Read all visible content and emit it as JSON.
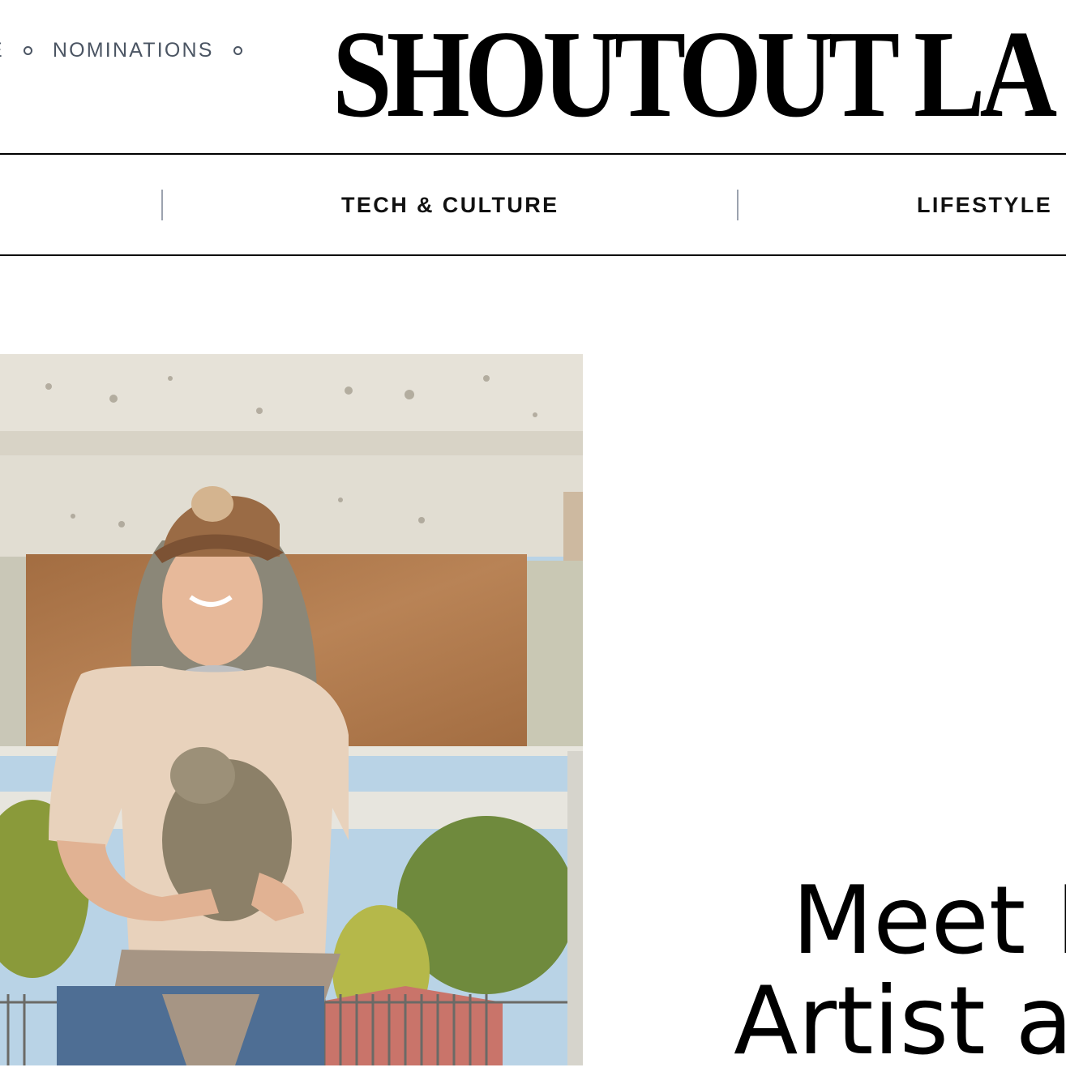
{
  "top_nav": {
    "partial_item": "E",
    "item": "NOMINATIONS"
  },
  "site": {
    "logo": "SHOUTOUT LA"
  },
  "category_nav": {
    "items": [
      "TECH & CULTURE",
      "LIFESTYLE"
    ]
  },
  "article": {
    "headline_line1": "Meet I",
    "headline_line2": "Artist a"
  },
  "colors": {
    "text": "#000000",
    "nav_gray": "#4b5563",
    "separator": "#9ca3af"
  },
  "icons": [
    "circle-bullet-icon"
  ]
}
